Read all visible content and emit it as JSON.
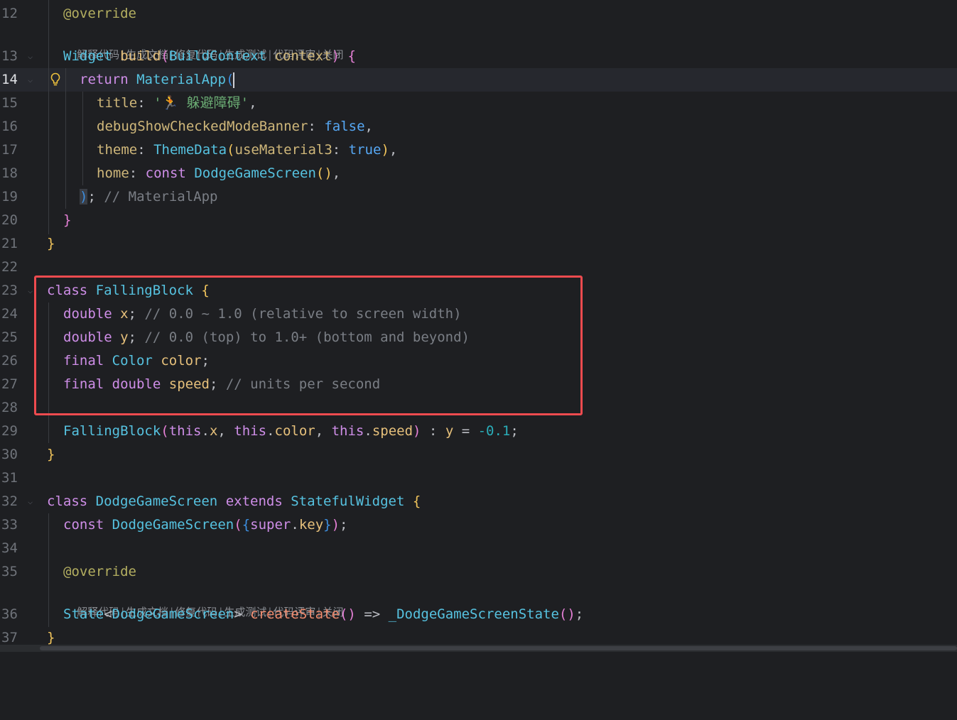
{
  "editor": {
    "language": "Dart",
    "current_line": "14",
    "line_numbers": [
      "12",
      "13",
      "14",
      "15",
      "16",
      "17",
      "18",
      "19",
      "20",
      "21",
      "22",
      "23",
      "24",
      "25",
      "26",
      "27",
      "28",
      "29",
      "30",
      "31",
      "32",
      "33",
      "34",
      "35",
      "36",
      "37"
    ],
    "code_vision_hint": {
      "items": [
        "解释代码",
        "生成文档",
        "修复代码",
        "生成测试",
        "代码评审",
        "关闭"
      ],
      "separator": "|"
    },
    "tokens": {
      "override": "@override",
      "widget": "Widget",
      "build": "build",
      "build_context": "BuildContext",
      "context": "context",
      "return": "return",
      "material_app": "MaterialApp",
      "title": "title",
      "title_value": "'🏃 躲避障碍'",
      "debug_banner": "debugShowCheckedModeBanner",
      "false_kw": "false",
      "theme": "theme",
      "theme_data": "ThemeData",
      "use_material3": "useMaterial3",
      "true_kw": "true",
      "home": "home",
      "const_kw": "const",
      "dodge_game_screen": "DodgeGameScreen",
      "material_app_comment": "// MaterialApp",
      "class_kw": "class",
      "falling_block": "FallingBlock",
      "double_kw": "double",
      "x": "x",
      "x_comment": "// 0.0 ~ 1.0 (relative to screen width)",
      "y": "y",
      "y_comment": "// 0.0 (top) to 1.0+ (bottom and beyond)",
      "final_kw": "final",
      "color_type": "Color",
      "color": "color",
      "speed": "speed",
      "speed_comment": "// units per second",
      "this_kw": "this",
      "neg_val": "-0.1",
      "extends_kw": "extends",
      "stateful_widget": "StatefulWidget",
      "super_kw": "super",
      "key": "key",
      "state_type": "State",
      "create_state": "createState",
      "arrow": "=>",
      "state_class": "_DodgeGameScreenState"
    }
  },
  "colors": {
    "background": "#1e1f22",
    "highlight_box": "#ee4b4f",
    "keyword": "#cf8ee8",
    "type": "#56c2e0",
    "comment": "#7a7e85",
    "string": "#6aab73"
  }
}
